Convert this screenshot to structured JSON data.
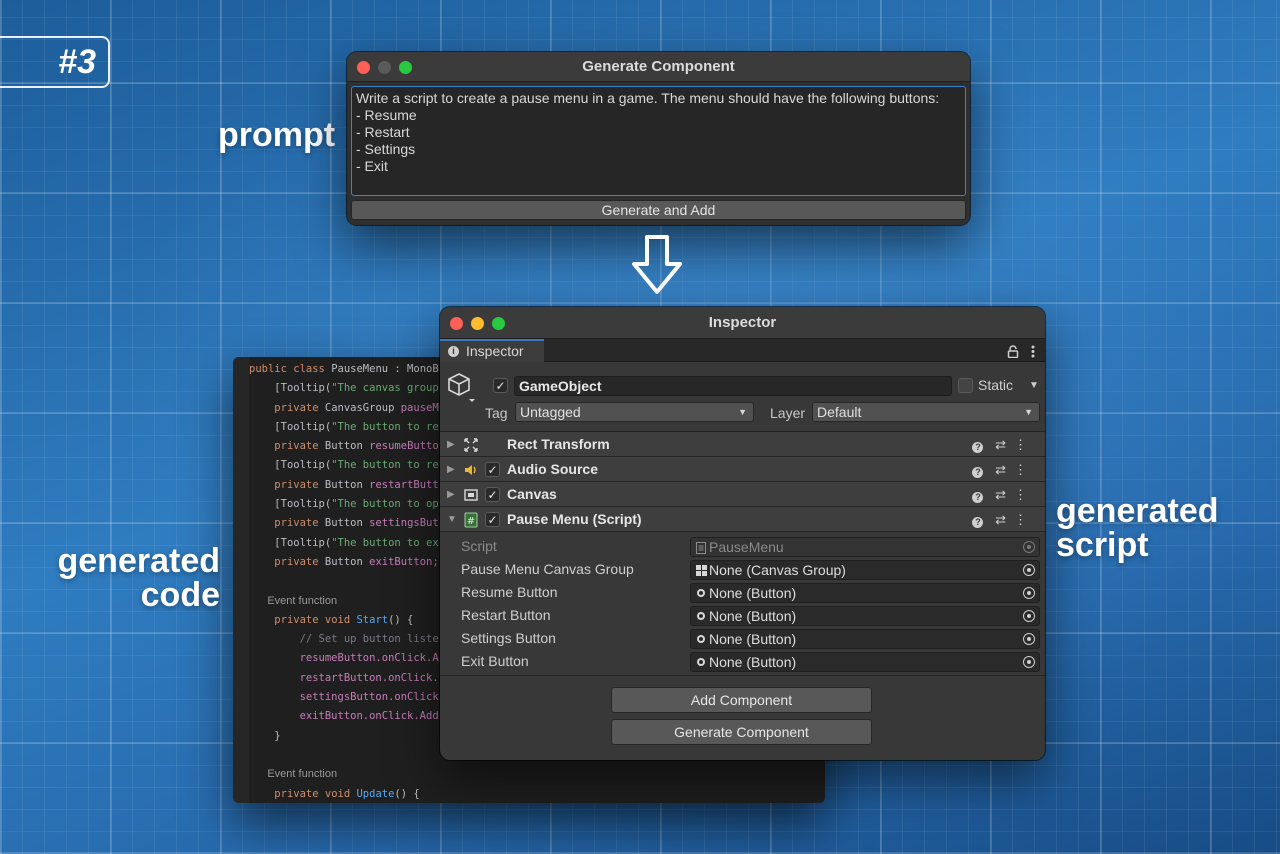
{
  "badge": "#3",
  "labels": {
    "prompt": "prompt",
    "generated_code_1": "generated",
    "generated_code_2": "code",
    "generated_script_1": "generated",
    "generated_script_2": "script"
  },
  "generate_window": {
    "title": "Generate Component",
    "prompt_text": "Write a script to create a pause menu in a game. The menu should have the following buttons:\n- Resume\n- Restart\n- Settings\n- Exit",
    "button": "Generate and Add"
  },
  "code": {
    "l1_kw": "public class ",
    "l1_name": "PauseMenu",
    "l1_rest": " : MonoB",
    "l2_a": "[Tooltip(",
    "l2_b": "\"The canvas group",
    "l3_kw": "private ",
    "l3_type": "CanvasGroup ",
    "l3_name": "pauseM",
    "l4_a": "[Tooltip(",
    "l4_b": "\"The button to re",
    "l5_kw": "private ",
    "l5_type": "Button ",
    "l5_name": "resumeButto",
    "l6_a": "[Tooltip(",
    "l6_b": "\"The button to re",
    "l7_kw": "private ",
    "l7_type": "Button ",
    "l7_name": "restartButt",
    "l8_a": "[Tooltip(",
    "l8_b": "\"The button to op",
    "l9_kw": "private ",
    "l9_type": "Button ",
    "l9_name": "settingsBut",
    "l10_a": "[Tooltip(",
    "l10_b": "\"The button to ex",
    "l11_kw": "private ",
    "l11_type": "Button ",
    "l11_name": "exitButton;",
    "hint1": "Event function",
    "l13_kw": "private void ",
    "l13_fn": "Start",
    "l13_rest": "() {",
    "l14": "// Set up button liste",
    "l15": "resumeButton.onClick.A",
    "l16": "restartButton.onClick.",
    "l17": "settingsButton.onClick",
    "l18": "exitButton.onClick.Add",
    "l19": "}",
    "hint2": "Event function",
    "l21_kw": "private void ",
    "l21_fn": "Update",
    "l21_rest": "() {"
  },
  "inspector": {
    "title": "Inspector",
    "tab": "Inspector",
    "tab_icons": "⌂ ⋮",
    "gameobject_name": "GameObject",
    "static_label": "Static",
    "tag_label": "Tag",
    "tag_value": "Untagged",
    "layer_label": "Layer",
    "layer_value": "Default",
    "components": [
      {
        "name": "Rect Transform",
        "checked": false
      },
      {
        "name": "Audio Source",
        "checked": true
      },
      {
        "name": "Canvas",
        "checked": true
      },
      {
        "name": "Pause Menu (Script)",
        "checked": true
      }
    ],
    "properties": [
      {
        "label": "Script",
        "value": "PauseMenu"
      },
      {
        "label": "Pause Menu Canvas Group",
        "value": "None (Canvas Group)"
      },
      {
        "label": "Resume Button",
        "value": "None (Button)"
      },
      {
        "label": "Restart Button",
        "value": "None (Button)"
      },
      {
        "label": "Settings Button",
        "value": "None (Button)"
      },
      {
        "label": "Exit Button",
        "value": "None (Button)"
      }
    ],
    "add_component": "Add Component",
    "generate_component": "Generate Component"
  }
}
